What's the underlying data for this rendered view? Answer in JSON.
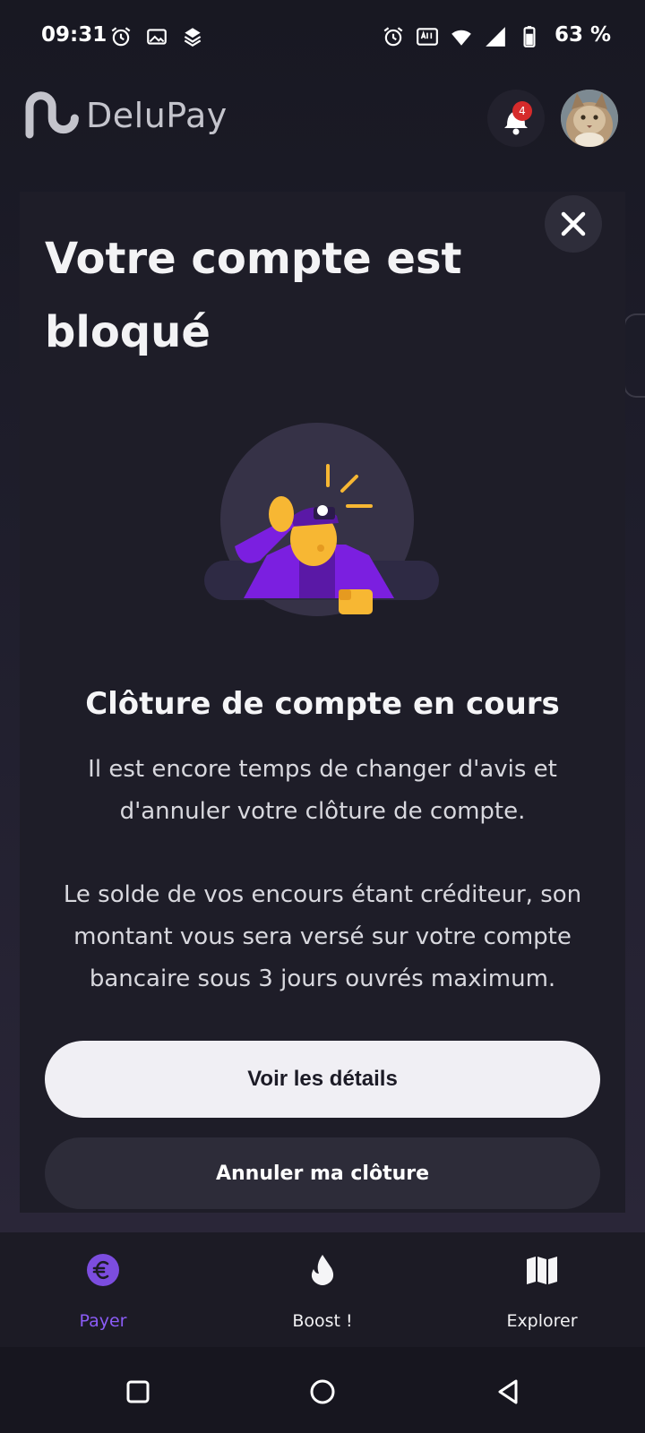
{
  "status_bar": {
    "time": "09:31",
    "battery_text": "63 %",
    "left_icons": [
      "alarm-icon",
      "image-icon",
      "stack-app-icon"
    ],
    "right_icons": [
      "alarm-icon",
      "auto-hz-icon",
      "wifi-icon",
      "signal-icon",
      "battery-icon"
    ]
  },
  "header": {
    "logo_text": "DeluPay",
    "notification_count": "4"
  },
  "modal": {
    "title": "Votre compte est bloqué",
    "subtitle": "Clôture de compte en cours",
    "paragraph_1": "Il est encore temps de changer d'avis et d'annuler votre clôture de compte.",
    "paragraph_2": "Le solde de vos encours étant créditeur, son montant vous sera versé sur votre compte bancaire sous 3 jours ouvrés maximum.",
    "primary_button": "Voir les détails",
    "secondary_button": "Annuler ma clôture"
  },
  "bottom_nav": {
    "items": [
      {
        "label": "Payer",
        "icon": "euro-icon",
        "active": true
      },
      {
        "label": "Boost !",
        "icon": "flame-icon",
        "active": false
      },
      {
        "label": "Explorer",
        "icon": "map-icon",
        "active": false
      }
    ]
  },
  "colors": {
    "accent": "#8b5cf6",
    "illustration_purple": "#7b1fe0",
    "illustration_orange": "#f7b733",
    "badge": "#d62b2b",
    "background": "#1e1d28"
  }
}
